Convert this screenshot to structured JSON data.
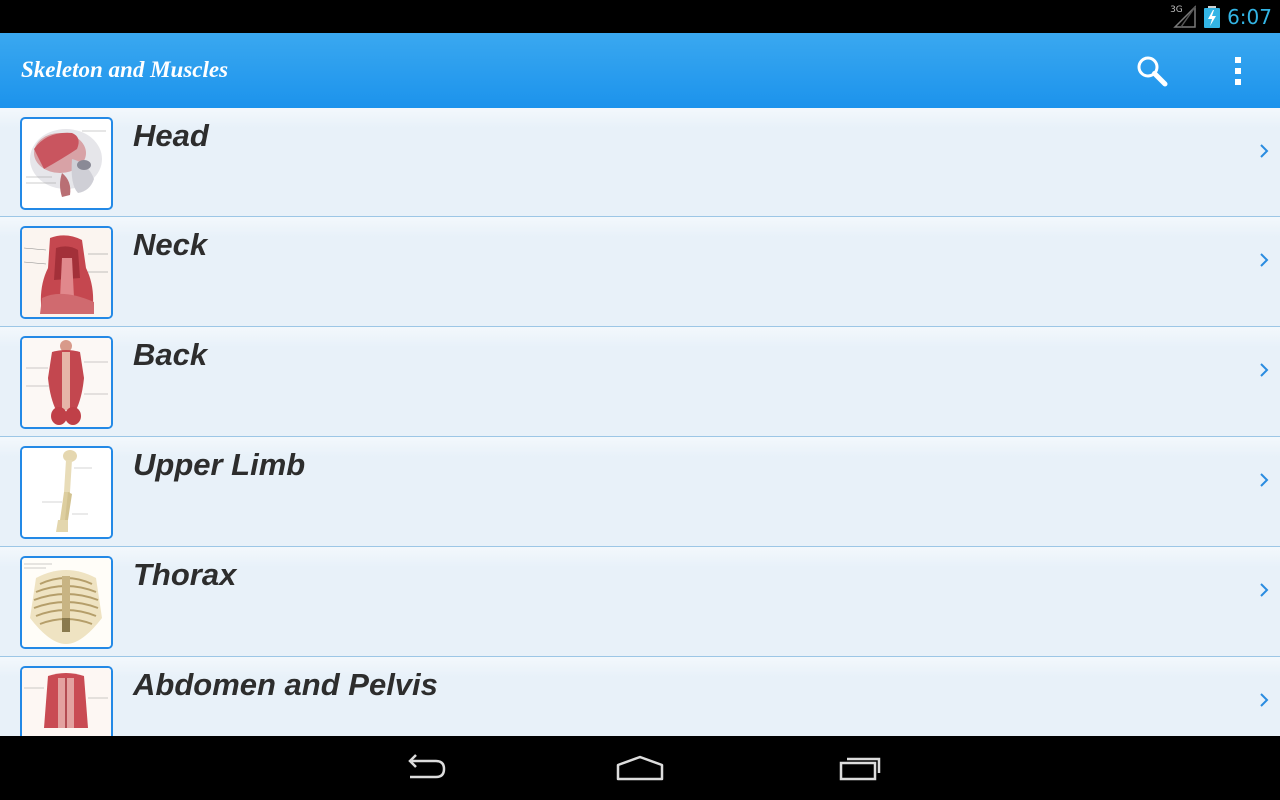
{
  "status_bar": {
    "network_label": "3G",
    "time": "6:07",
    "icons": [
      "signal-icon",
      "battery-charging-icon"
    ]
  },
  "action_bar": {
    "title": "Skeleton and Muscles",
    "actions": [
      {
        "name": "search",
        "icon": "search-icon"
      },
      {
        "name": "overflow-menu",
        "icon": "more-vertical-icon"
      }
    ]
  },
  "sections": [
    {
      "label": "Head",
      "thumbnail": "head-muscles-illustration"
    },
    {
      "label": "Neck",
      "thumbnail": "neck-muscles-illustration"
    },
    {
      "label": "Back",
      "thumbnail": "back-muscles-illustration"
    },
    {
      "label": "Upper Limb",
      "thumbnail": "arm-bones-illustration"
    },
    {
      "label": "Thorax",
      "thumbnail": "rib-cage-illustration"
    },
    {
      "label": "Abdomen and Pelvis",
      "thumbnail": "abdomen-muscles-illustration"
    }
  ],
  "nav_bar": {
    "buttons": [
      "back-icon",
      "home-icon",
      "recent-apps-icon"
    ]
  },
  "colors": {
    "accent": "#33b5e5",
    "action_bar": "#1c93ec",
    "list_background": "#e9f2f9",
    "thumbnail_border": "#2389e6",
    "divider": "#9cc6e6"
  }
}
